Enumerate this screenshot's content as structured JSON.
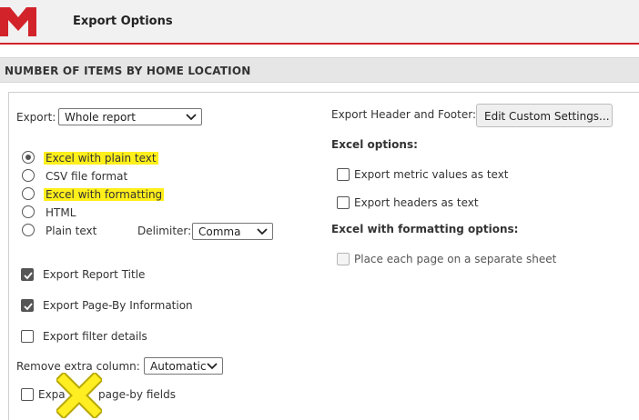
{
  "header": {
    "title": "Export Options"
  },
  "section": {
    "title": "NUMBER OF ITEMS BY HOME LOCATION"
  },
  "export": {
    "label": "Export:",
    "value": "Whole report"
  },
  "formats": [
    {
      "label": "Excel with plain text",
      "selected": true,
      "highlighted": true
    },
    {
      "label": "CSV file format",
      "selected": false,
      "highlighted": false
    },
    {
      "label": "Excel with formatting",
      "selected": false,
      "highlighted": true
    },
    {
      "label": "HTML",
      "selected": false,
      "highlighted": false
    },
    {
      "label": "Plain text",
      "selected": false,
      "highlighted": false
    }
  ],
  "delimiter": {
    "label": "Delimiter:",
    "value": "Comma"
  },
  "options": {
    "report_title": {
      "label": "Export Report Title",
      "checked": true
    },
    "page_by": {
      "label": "Export Page-By Information",
      "checked": true
    },
    "filter_details": {
      "label": "Export filter details",
      "checked": false
    }
  },
  "remove_extra": {
    "label": "Remove extra column:",
    "value": "Automatic"
  },
  "expand": {
    "label_a": "Expa",
    "label_b": "page-by fields",
    "checked": false
  },
  "header_footer": {
    "label": "Export Header and Footer:",
    "button": "Edit Custom Settings..."
  },
  "excel_options": {
    "title": "Excel options:",
    "metric_text": {
      "label": "Export metric values as text",
      "checked": false
    },
    "headers_text": {
      "label": "Export headers as text",
      "checked": false
    }
  },
  "excel_formatting": {
    "title": "Excel with formatting options:",
    "separate_sheet": {
      "label": "Place each page on a separate sheet",
      "checked": false,
      "disabled": true
    }
  },
  "colors": {
    "accent": "#d2232a",
    "highlight": "#ffef1a",
    "cross": "#ffee22"
  }
}
